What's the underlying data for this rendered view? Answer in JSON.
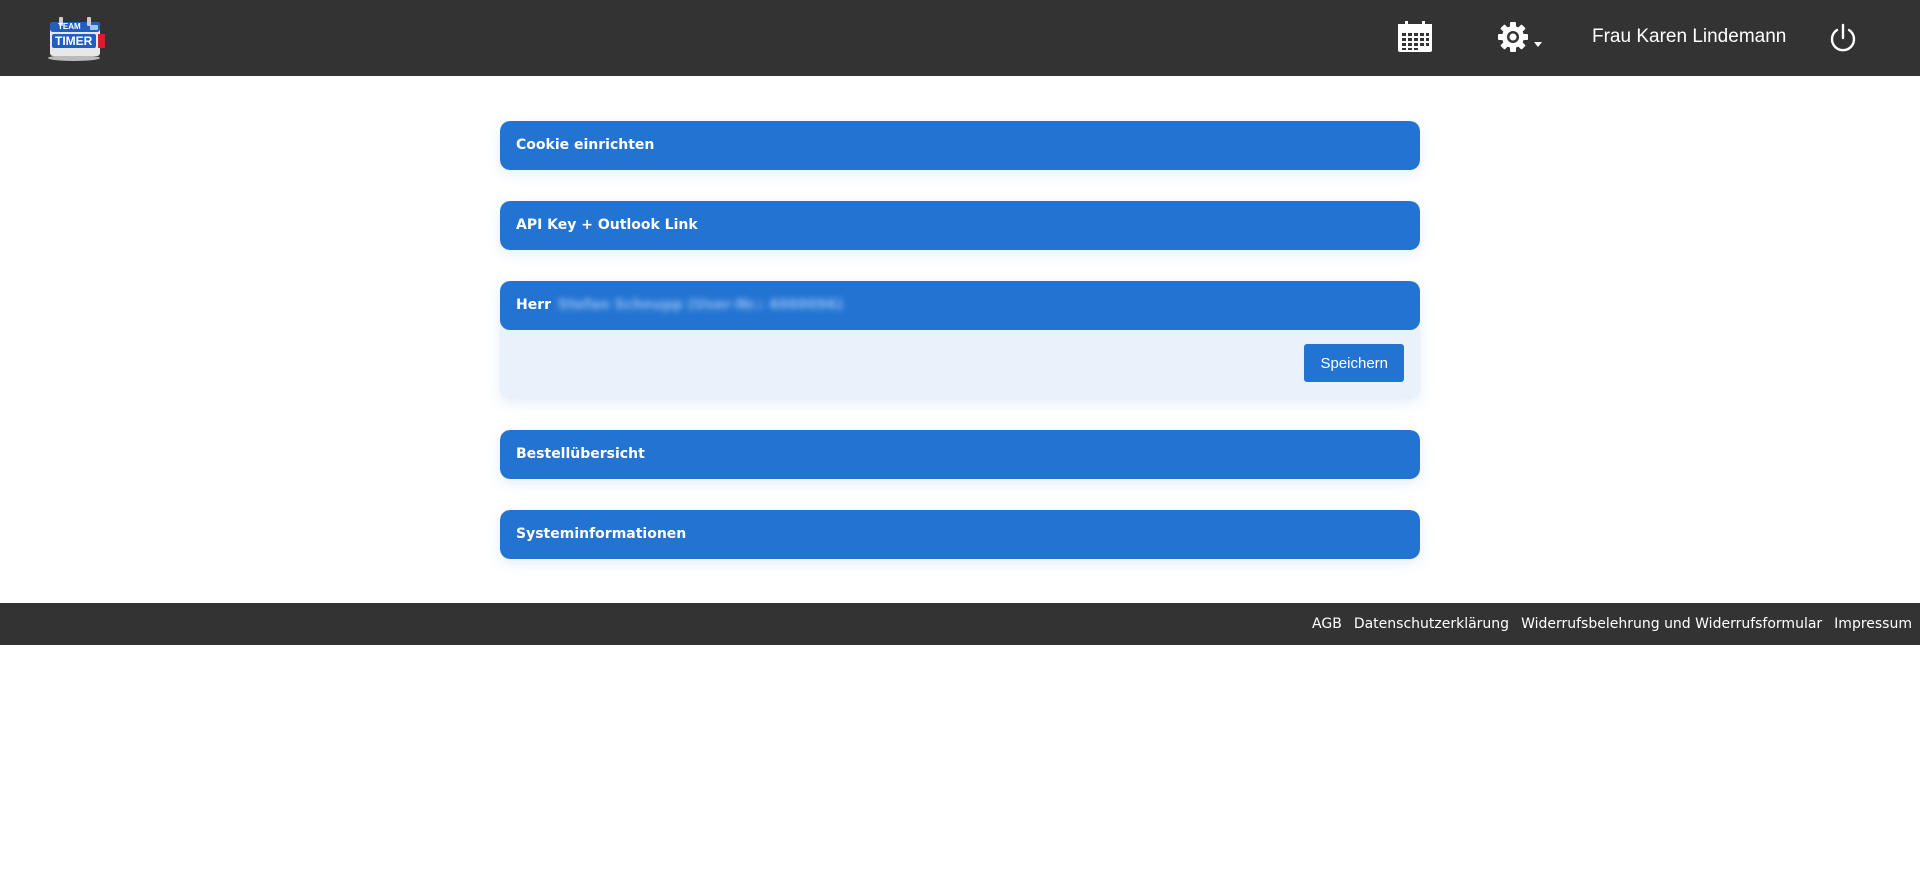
{
  "header": {
    "logo": {
      "top_text": "TEAM",
      "main_text": "TIMER",
      "icon": "team-timer-logo"
    },
    "calendar_icon": "calendar-icon",
    "settings_icon": "gear-icon",
    "dropdown_icon": "chevron-down-icon",
    "user_name": "Frau Karen Lindemann",
    "power_icon": "power-icon"
  },
  "panels": [
    {
      "title": "Cookie einrichten"
    },
    {
      "title": "API Key + Outlook Link"
    },
    {
      "title": "Herr",
      "subtitle_blurred": "Stefan Schnupp (User-Nr.: 4000096)",
      "save_label": "Speichern"
    },
    {
      "title": "Bestellübersicht"
    },
    {
      "title": "Systeminformationen"
    }
  ],
  "footer": {
    "links": [
      "AGB",
      "Datenschutzerklärung",
      "Widerrufsbelehrung und Widerrufsformular",
      "Impressum"
    ]
  },
  "colors": {
    "header_bg": "#333333",
    "accent": "#2374d2",
    "panel_open_bg": "#e9f1fb"
  }
}
